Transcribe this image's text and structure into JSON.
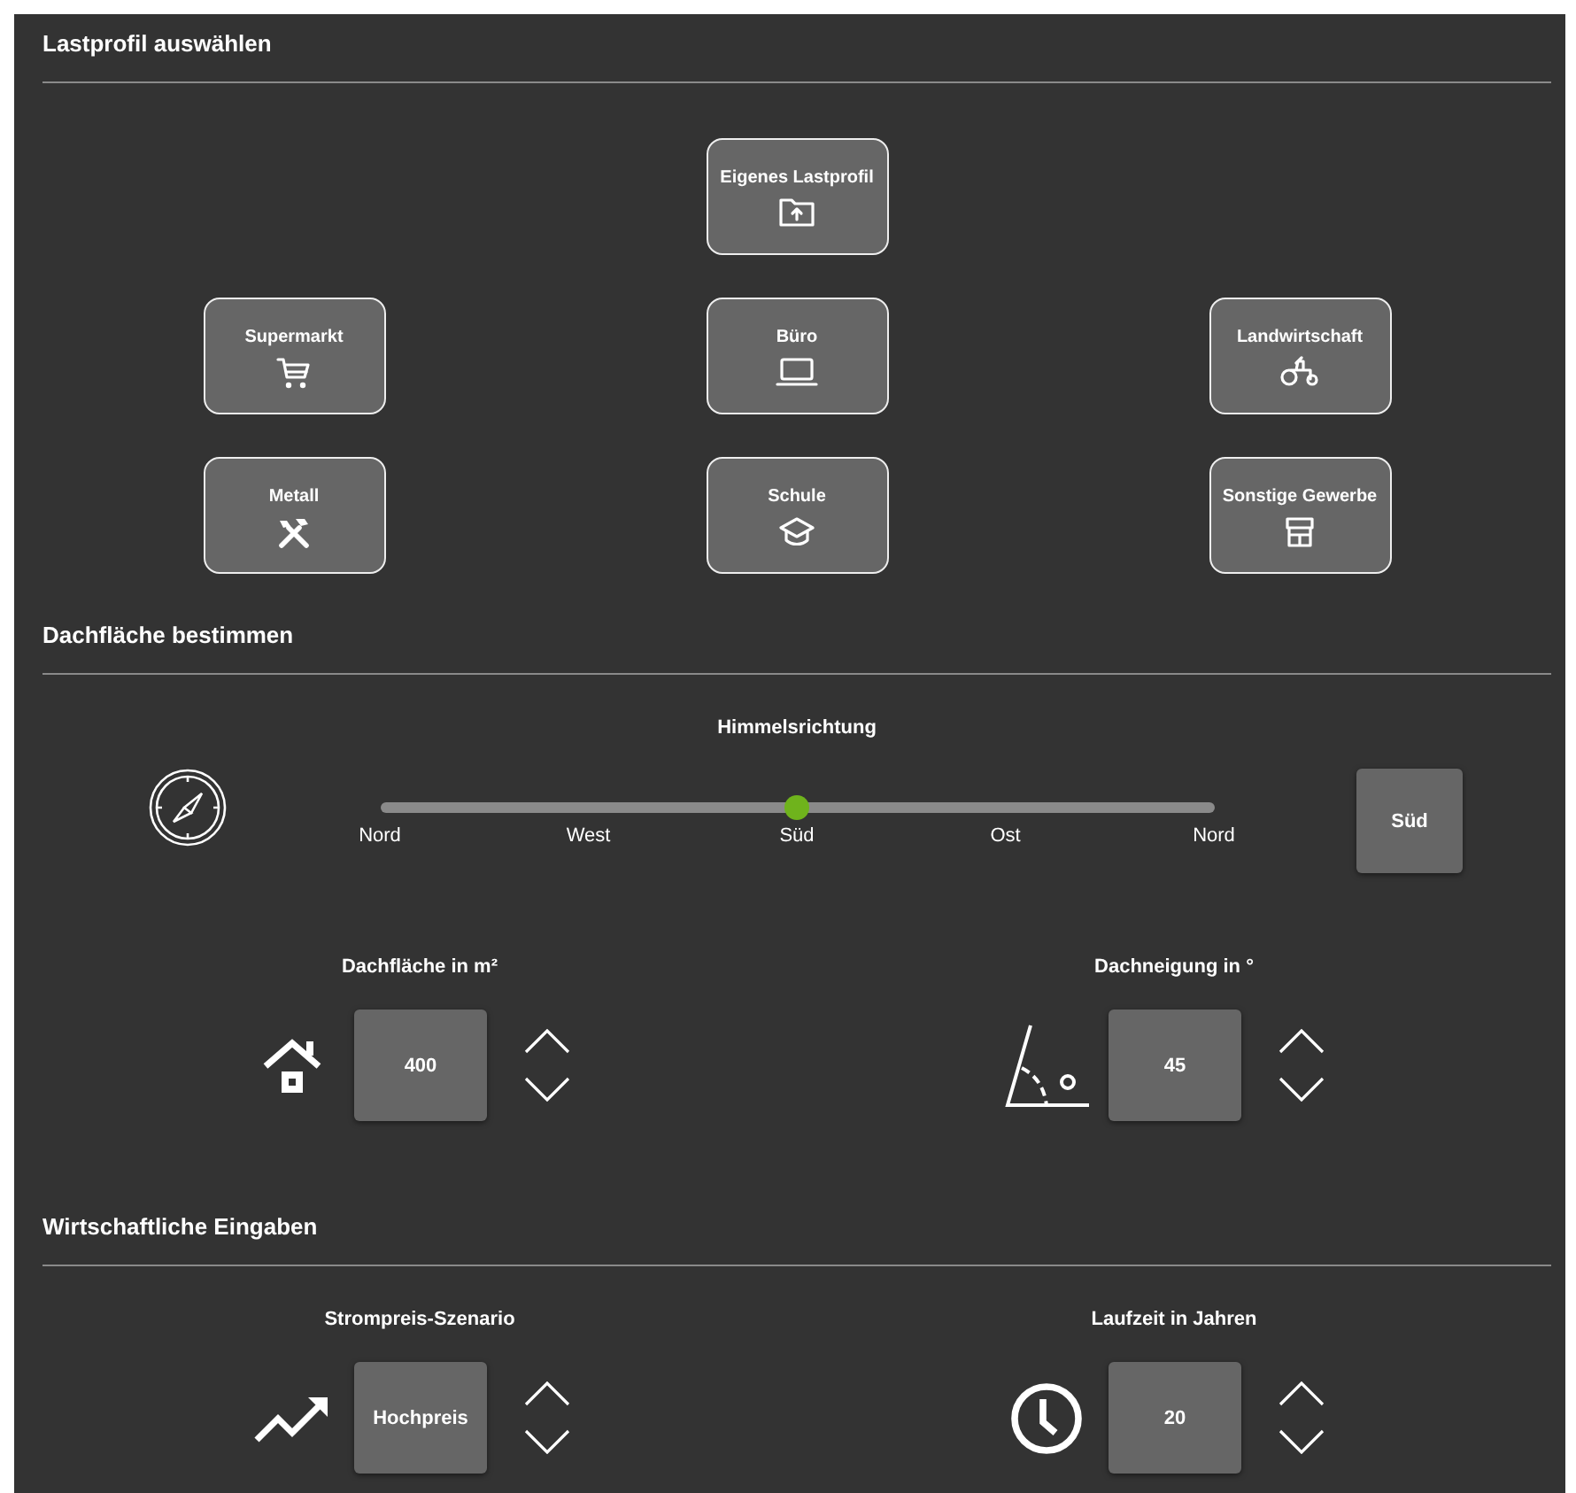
{
  "load_profile": {
    "title": "Lastprofil auswählen",
    "profiles": [
      {
        "label": "Eigenes Lastprofil"
      },
      {
        "label": "Supermarkt"
      },
      {
        "label": "Büro"
      },
      {
        "label": "Landwirtschaft"
      },
      {
        "label": "Metall"
      },
      {
        "label": "Schule"
      },
      {
        "label": "Sonstige Gewerbe"
      }
    ]
  },
  "roof": {
    "title": "Dachfläche bestimmen",
    "direction": {
      "label": "Himmelsrichtung",
      "level": 0.5,
      "ticks": [
        "Nord",
        "West",
        "Süd",
        "Ost",
        "Nord"
      ],
      "value": "Süd"
    },
    "steppers": [
      {
        "label": "Dachfläche in m²",
        "value": "400"
      },
      {
        "label": "Dachneigung in °",
        "value": "45"
      }
    ]
  },
  "economics": {
    "title": "Wirtschaftliche Eingaben",
    "steppers": [
      {
        "label": "Strompreis-Szenario",
        "value": "Hochpreis"
      },
      {
        "label": "Laufzeit in Jahren",
        "value": "20"
      }
    ]
  }
}
